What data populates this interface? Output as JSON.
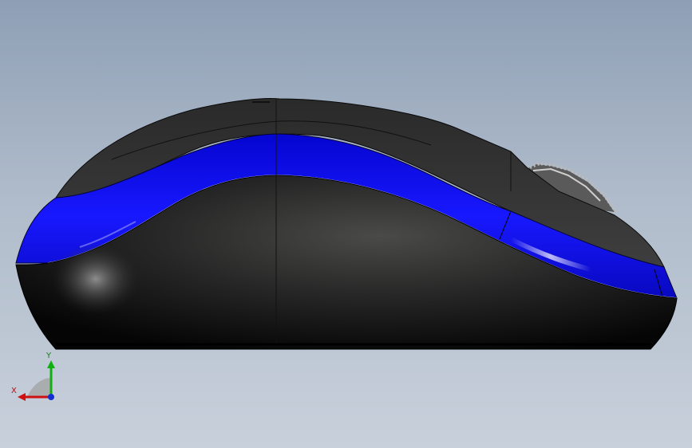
{
  "viewport": {
    "background_top": "#8e9fb5",
    "background_bottom": "#c8d0db"
  },
  "model": {
    "shell_color": "#1a1a1a",
    "stripe_color": "#1010ee",
    "wheel_color": "#888888"
  },
  "triad": {
    "x_label": "X",
    "y_label": "Y",
    "x_color": "#d01010",
    "y_color": "#10b010",
    "z_color": "#1030d0"
  }
}
